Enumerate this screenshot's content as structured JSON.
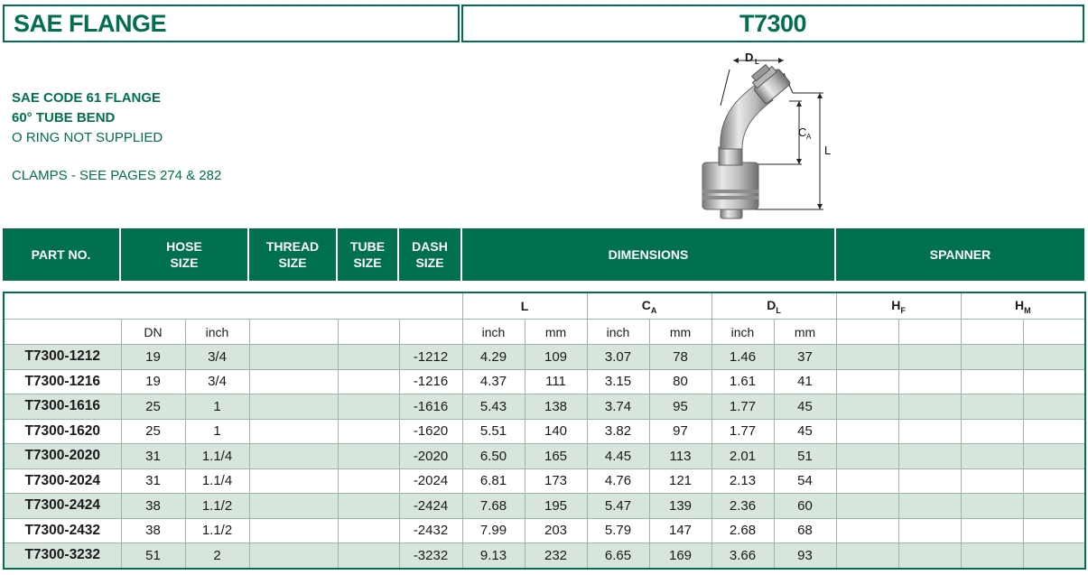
{
  "header": {
    "title_left": "SAE FLANGE",
    "title_right": "T7300"
  },
  "description": {
    "line1": "SAE CODE 61 FLANGE",
    "line2": "60° TUBE BEND",
    "line3": "O RING NOT SUPPLIED",
    "line4": "CLAMPS - SEE PAGES 274 & 282"
  },
  "diagram": {
    "dl": "D",
    "dl_sub": "L",
    "ca": "C",
    "ca_sub": "A",
    "l": "L"
  },
  "table_header": {
    "part_no": "PART NO.",
    "hose_size_1": "HOSE",
    "hose_size_2": "SIZE",
    "thread_size_1": "THREAD",
    "thread_size_2": "SIZE",
    "tube_size_1": "TUBE",
    "tube_size_2": "SIZE",
    "dash_size_1": "DASH",
    "dash_size_2": "SIZE",
    "dimensions": "DIMENSIONS",
    "spanner": "SPANNER"
  },
  "groups": {
    "l": "L",
    "ca": "C",
    "ca_sub": "A",
    "dl": "D",
    "dl_sub": "L",
    "hf": "H",
    "hf_sub": "F",
    "hm": "H",
    "hm_sub": "M"
  },
  "subheaders": {
    "dn": "DN",
    "inch": "inch",
    "l_inch": "inch",
    "l_mm": "mm",
    "ca_inch": "inch",
    "ca_mm": "mm",
    "dl_inch": "inch",
    "dl_mm": "mm"
  },
  "rows": [
    {
      "part": "T7300-1212",
      "dn": "19",
      "inch": "3/4",
      "thread": "",
      "tube": "",
      "dash": "-1212",
      "l_in": "4.29",
      "l_mm": "109",
      "ca_in": "3.07",
      "ca_mm": "78",
      "dl_in": "1.46",
      "dl_mm": "37"
    },
    {
      "part": "T7300-1216",
      "dn": "19",
      "inch": "3/4",
      "thread": "",
      "tube": "",
      "dash": "-1216",
      "l_in": "4.37",
      "l_mm": "111",
      "ca_in": "3.15",
      "ca_mm": "80",
      "dl_in": "1.61",
      "dl_mm": "41"
    },
    {
      "part": "T7300-1616",
      "dn": "25",
      "inch": "1",
      "thread": "",
      "tube": "",
      "dash": "-1616",
      "l_in": "5.43",
      "l_mm": "138",
      "ca_in": "3.74",
      "ca_mm": "95",
      "dl_in": "1.77",
      "dl_mm": "45"
    },
    {
      "part": "T7300-1620",
      "dn": "25",
      "inch": "1",
      "thread": "",
      "tube": "",
      "dash": "-1620",
      "l_in": "5.51",
      "l_mm": "140",
      "ca_in": "3.82",
      "ca_mm": "97",
      "dl_in": "1.77",
      "dl_mm": "45"
    },
    {
      "part": "T7300-2020",
      "dn": "31",
      "inch": "1.1/4",
      "thread": "",
      "tube": "",
      "dash": "-2020",
      "l_in": "6.50",
      "l_mm": "165",
      "ca_in": "4.45",
      "ca_mm": "113",
      "dl_in": "2.01",
      "dl_mm": "51"
    },
    {
      "part": "T7300-2024",
      "dn": "31",
      "inch": "1.1/4",
      "thread": "",
      "tube": "",
      "dash": "-2024",
      "l_in": "6.81",
      "l_mm": "173",
      "ca_in": "4.76",
      "ca_mm": "121",
      "dl_in": "2.13",
      "dl_mm": "54"
    },
    {
      "part": "T7300-2424",
      "dn": "38",
      "inch": "1.1/2",
      "thread": "",
      "tube": "",
      "dash": "-2424",
      "l_in": "7.68",
      "l_mm": "195",
      "ca_in": "5.47",
      "ca_mm": "139",
      "dl_in": "2.36",
      "dl_mm": "60"
    },
    {
      "part": "T7300-2432",
      "dn": "38",
      "inch": "1.1/2",
      "thread": "",
      "tube": "",
      "dash": "-2432",
      "l_in": "7.99",
      "l_mm": "203",
      "ca_in": "5.79",
      "ca_mm": "147",
      "dl_in": "2.68",
      "dl_mm": "68"
    },
    {
      "part": "T7300-3232",
      "dn": "51",
      "inch": "2",
      "thread": "",
      "tube": "",
      "dash": "-3232",
      "l_in": "9.13",
      "l_mm": "232",
      "ca_in": "6.65",
      "ca_mm": "169",
      "dl_in": "3.66",
      "dl_mm": "93"
    }
  ],
  "colors": {
    "brand_green": "#00704e",
    "row_shade": "#d7e5dc"
  }
}
